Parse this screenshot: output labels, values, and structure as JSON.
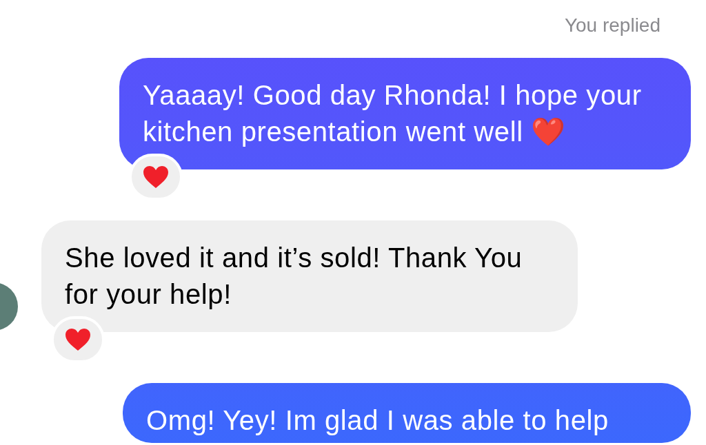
{
  "status_label": "You replied",
  "messages": [
    {
      "kind": "outgoing",
      "text": "Yaaaay! Good day Rhonda! I hope your kitchen presentation went well ❤️",
      "reacted": true
    },
    {
      "kind": "incoming",
      "text": "She loved it and it’s sold! Thank You for your help!",
      "reacted": true
    },
    {
      "kind": "outgoing",
      "text": "Omg! Yey! Im glad I was able to help",
      "reacted": false
    }
  ]
}
